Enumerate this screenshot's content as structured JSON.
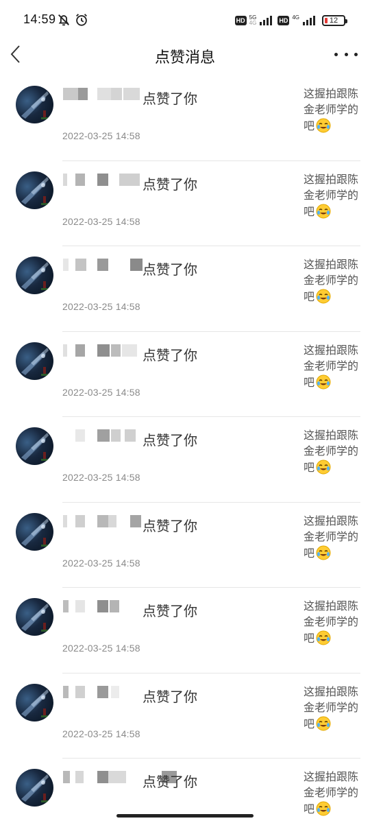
{
  "status_bar": {
    "time": "14:59",
    "sim1": {
      "badge": "HD",
      "net_top": "5G",
      "net_bottom": "4G"
    },
    "sim2": {
      "badge": "HD",
      "net_top": "4G"
    },
    "battery": "12"
  },
  "header": {
    "title": "点赞消息"
  },
  "items": [
    {
      "action": "点赞了你",
      "date": "2022-03-25 14:58",
      "preview": "这握拍跟陈金老师学的吧"
    },
    {
      "action": "点赞了你",
      "date": "2022-03-25 14:58",
      "preview": "这握拍跟陈金老师学的吧"
    },
    {
      "action": "点赞了你",
      "date": "2022-03-25 14:58",
      "preview": "这握拍跟陈金老师学的吧"
    },
    {
      "action": "点赞了你",
      "date": "2022-03-25 14:58",
      "preview": "这握拍跟陈金老师学的吧"
    },
    {
      "action": "点赞了你",
      "date": "2022-03-25 14:58",
      "preview": "这握拍跟陈金老师学的吧"
    },
    {
      "action": "点赞了你",
      "date": "2022-03-25 14:58",
      "preview": "这握拍跟陈金老师学的吧"
    },
    {
      "action": "点赞了你",
      "date": "2022-03-25 14:58",
      "preview": "这握拍跟陈金老师学的吧"
    },
    {
      "action": "点赞了你",
      "date": "2022-03-25 14:58",
      "preview": "这握拍跟陈金老师学的吧"
    },
    {
      "action": "点赞了你",
      "date": "",
      "preview": "这握拍跟陈金老师学的吧"
    }
  ],
  "icons": {
    "back": "back-arrow-icon",
    "more": "more-dots-icon",
    "emoji": "laughing-crying-emoji-icon",
    "mute": "bell-muted-icon",
    "alarm": "alarm-clock-icon"
  }
}
